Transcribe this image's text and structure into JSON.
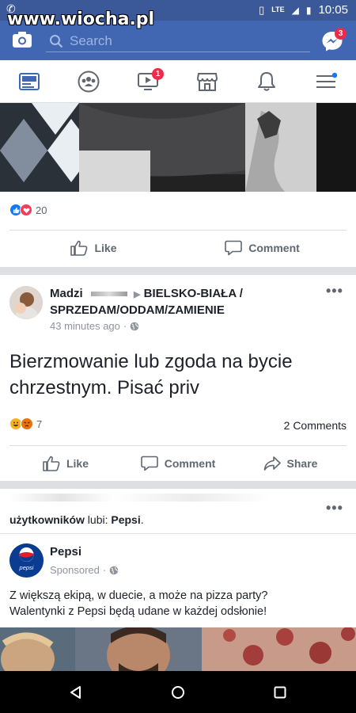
{
  "status_bar": {
    "network": "LTE",
    "time": "10:05"
  },
  "watermark": "www.wiocha.pl",
  "topbar": {
    "search_placeholder": "Search",
    "messenger_badge": "3"
  },
  "tabs": [
    {
      "name": "news-feed-icon"
    },
    {
      "name": "groups-icon"
    },
    {
      "name": "watch-icon",
      "badge": "1"
    },
    {
      "name": "marketplace-icon"
    },
    {
      "name": "notifications-icon"
    },
    {
      "name": "menu-icon"
    }
  ],
  "post1": {
    "reaction_count": "20",
    "actions": {
      "like": "Like",
      "comment": "Comment"
    }
  },
  "post2": {
    "author": "Madzi",
    "group": "BIELSKO-BIAŁA / SPRZEDAM/ODDAM/ZAMIENIE",
    "time": "43 minutes ago",
    "text": "Bierzmowanie lub zgoda na bycie chrzestnym. Pisać priv",
    "reaction_count": "7",
    "comments": "2 Comments",
    "actions": {
      "like": "Like",
      "comment": "Comment",
      "share": "Share"
    }
  },
  "post3": {
    "header_bold": "użytkowników",
    "header_mid": " lubi: ",
    "header_page": "Pepsi",
    "header_end": ".",
    "page_name": "Pepsi",
    "logo_text": "pepsi",
    "sponsored": "Sponsored",
    "text_line1": "Z większą ekipą, w duecie, a może na pizza party?",
    "text_line2": "Walentynki z Pepsi będą udane w każdej odsłonie!"
  },
  "colors": {
    "brand": "#4267b2",
    "statusbar": "#3b5998",
    "badge": "#f02849",
    "like_blue": "#1877f2",
    "love_red": "#f33e58"
  }
}
